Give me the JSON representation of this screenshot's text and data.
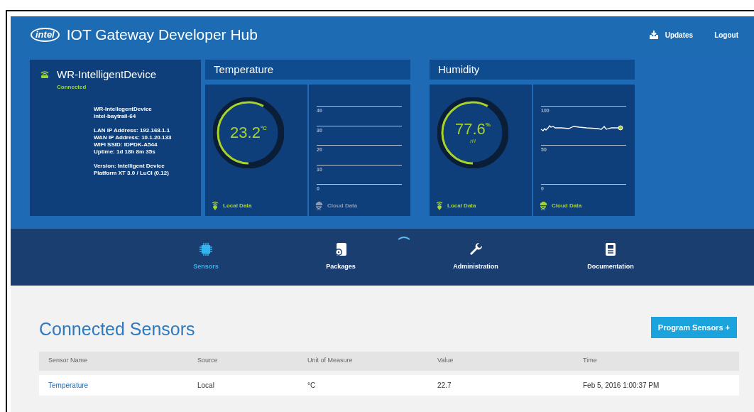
{
  "header": {
    "logo": "intel",
    "title": "IOT Gateway Developer Hub",
    "links": [
      {
        "kind": "updates",
        "label": "Updates"
      },
      {
        "kind": "plain",
        "label": "Logout"
      }
    ]
  },
  "device": {
    "name": "WR-IntelligentDevice",
    "status": "Connected",
    "info": [
      [
        "WR-IntellegentDevice",
        "intel-baytrail-64"
      ],
      [
        "LAN IP Address: 192.168.1.1",
        "WAN IP Address: 10.1.20.133",
        "WIFI SSID: IDPDK-A544",
        "Uptime: 1d 18h 8m 35s"
      ],
      [
        "Version: Intelligent Device",
        "Platform XT 3.0 / LuCI (0.12)"
      ]
    ]
  },
  "sensor_panels": [
    {
      "title": "Temperature",
      "value": "23.2",
      "unit": "°C",
      "local_label": "Local Data",
      "cloud_label": "Cloud Data",
      "cloud_active": false,
      "axis_labels": [
        "40",
        "30",
        "20",
        "10",
        "0"
      ],
      "has_line": false
    },
    {
      "title": "Humidity",
      "value": "77.6",
      "unit": "%",
      "sub": "rH",
      "local_label": "Local Data",
      "cloud_label": "Cloud Data",
      "cloud_active": true,
      "axis_labels": [
        "100",
        "50",
        "0"
      ],
      "has_line": true
    }
  ],
  "nav": [
    {
      "kind": "chip",
      "label": "Sensors",
      "selected": true
    },
    {
      "kind": "package",
      "label": "Packages",
      "selected": false
    },
    {
      "kind": "wrench",
      "label": "Administration",
      "selected": false
    },
    {
      "kind": "doc",
      "label": "Documentation",
      "selected": false
    }
  ],
  "content": {
    "heading": "Connected Sensors",
    "button": "Program Sensors +",
    "table": {
      "columns": [
        "Sensor Name",
        "Source",
        "Unit of Measure",
        "Value",
        "Time"
      ],
      "rows": [
        [
          "Temperature",
          "Local",
          "°C",
          "22.7",
          "Feb 5, 2016 1:00:37 PM"
        ]
      ]
    }
  }
}
